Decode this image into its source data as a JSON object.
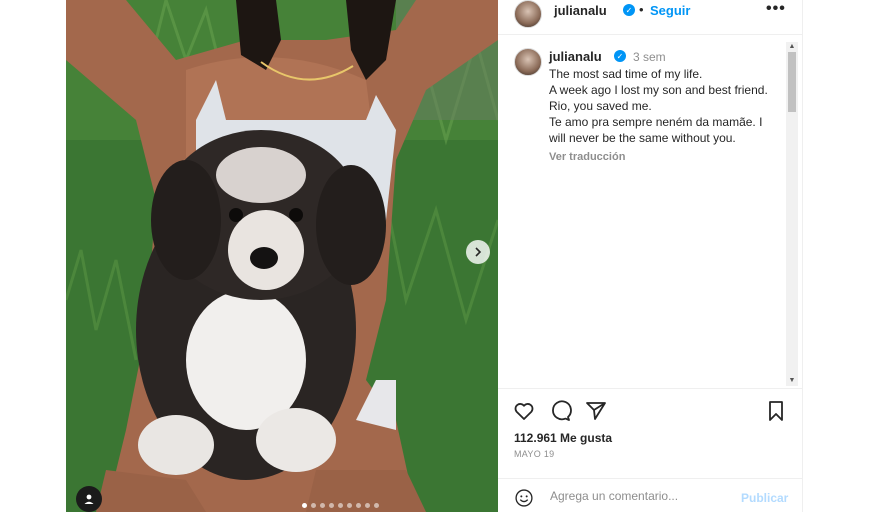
{
  "header": {
    "username": "julianalu",
    "separator": "•",
    "follow_label": "Seguir",
    "more_label": "•••"
  },
  "caption": {
    "username": "julianalu",
    "time_ago": "3 sem",
    "text": "The most sad time of my life.\nA week ago I lost my son and best friend. Rio, you saved me.\nTe amo pra sempre neném da mamãe. I will never be the same without you.",
    "translate_label": "Ver traducción"
  },
  "actions": {
    "likes": "112.961 Me gusta",
    "date": "MAYO 19"
  },
  "comment": {
    "placeholder": "Agrega un comentario...",
    "publish_label": "Publicar"
  },
  "carousel": {
    "slides": 9,
    "active_index": 1
  },
  "colors": {
    "accent": "#0095f6",
    "verified": "#0095f6",
    "publish_disabled": "#b3dbff"
  },
  "icons": {
    "like": "heart-icon",
    "comment": "comment-icon",
    "share": "send-icon",
    "save": "bookmark-icon",
    "emoji": "emoji-icon",
    "next": "chevron-right-icon",
    "tag": "user-tag-icon"
  }
}
